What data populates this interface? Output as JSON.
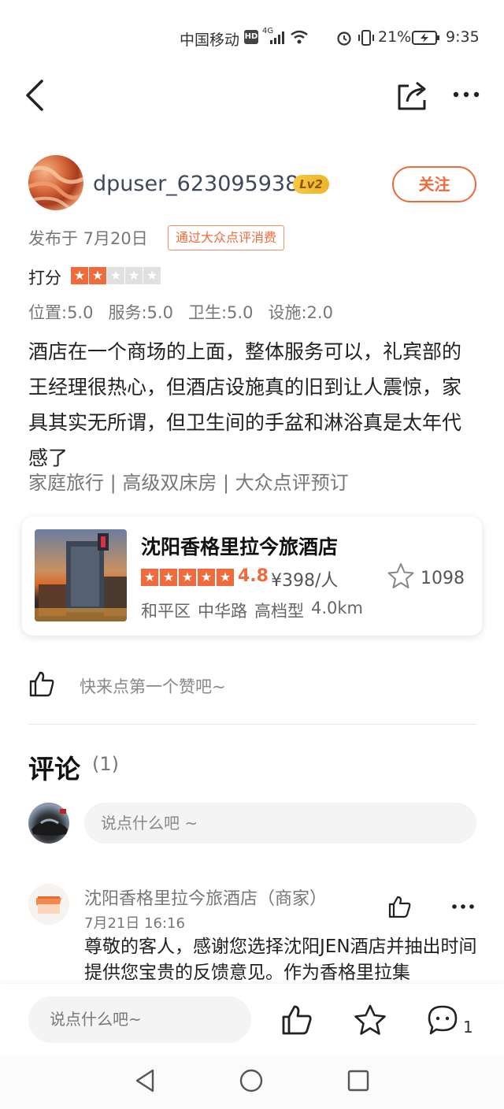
{
  "status_bar": {
    "carrier": "中国移动",
    "hd": "HD",
    "network": "4G",
    "battery": "21%",
    "time": "9:35"
  },
  "nav": {
    "back_icon": "chevron-left-icon",
    "share_icon": "share-icon",
    "more_icon": "more-icon"
  },
  "author": {
    "username": "dpuser_6230959382",
    "level": "Lv2",
    "follow_label": "关注",
    "publish_date": "发布于 7月20日",
    "consume_badge": "通过大众点评消费"
  },
  "rating": {
    "label": "打分",
    "stars_filled": 2,
    "stars_total": 5,
    "scores": [
      "位置:5.0",
      "服务:5.0",
      "卫生:5.0",
      "设施:2.0"
    ]
  },
  "review": {
    "text": "酒店在一个商场的上面，整体服务可以，礼宾部的王经理很热心，但酒店设施真的旧到让人震惊，家具其实无所谓，但卫生间的手盆和淋浴真是太年代感了",
    "tags": "家庭旅行 | 高级双床房 | 大众点评预订"
  },
  "shop": {
    "name": "沈阳香格里拉今旅酒店",
    "stars": 5,
    "score": "4.8",
    "price": "¥398/人",
    "favorites": "1098",
    "meta": [
      "和平区",
      "中华路",
      "高档型",
      "4.0km"
    ]
  },
  "likes": {
    "prompt": "快来点第一个赞吧~"
  },
  "comments": {
    "title": "评论",
    "count": "(1)",
    "input_placeholder": "说点什么吧 ~",
    "items": [
      {
        "author": "沈阳香格里拉今旅酒店（商家）",
        "time": "7月21日  16:16",
        "text": "尊敬的客人，感谢您选择沈阳JEN酒店并抽出时间提供您宝贵的反馈意见。作为香格里拉集"
      }
    ]
  },
  "bottom_bar": {
    "input_placeholder": "说点什么吧~",
    "comment_count": "1"
  },
  "colors": {
    "accent": "#f16a3b",
    "star_empty": "#e0e0e0",
    "text_secondary": "#777777"
  }
}
